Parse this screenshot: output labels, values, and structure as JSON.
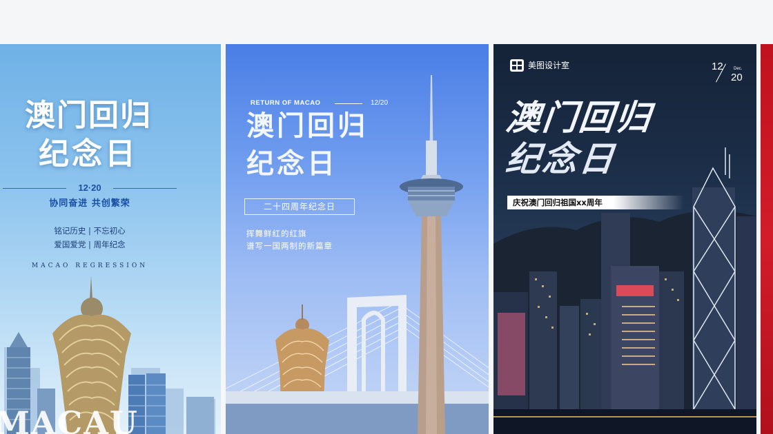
{
  "cards": [
    {
      "title_line1": "澳门回归",
      "title_line2": "纪念日",
      "date": "12·20",
      "slogan": "协同奋进 共创繁荣",
      "sub_line1": "铭记历史 | 不忘初心",
      "sub_line2": "爱国爱党 | 周年纪念",
      "english": "MACAO REGRESSION",
      "watermark": "MACAU"
    },
    {
      "return_text": "RETURN OF MACAO",
      "date": "12/20",
      "title_line1": "澳门回归",
      "title_line2": "纪念日",
      "box_text": "二十四周年纪念日",
      "desc_line1": "挥舞鲜红的红旗",
      "desc_line2": "谱写一国两制的新篇章"
    },
    {
      "brand": "美图设计室",
      "month": "12",
      "month_name": "Dec.",
      "day": "20",
      "title_line1": "澳门回归",
      "title_line2": "纪念日",
      "banner": "庆祝澳门回归祖国xx周年"
    }
  ],
  "colors": {
    "page_bg": "#f5f6f8",
    "card1_accent": "#1b4fa3",
    "card2_sky": "#4a7ee6",
    "card3_night": "#152338",
    "card4_red": "#c0121e"
  }
}
